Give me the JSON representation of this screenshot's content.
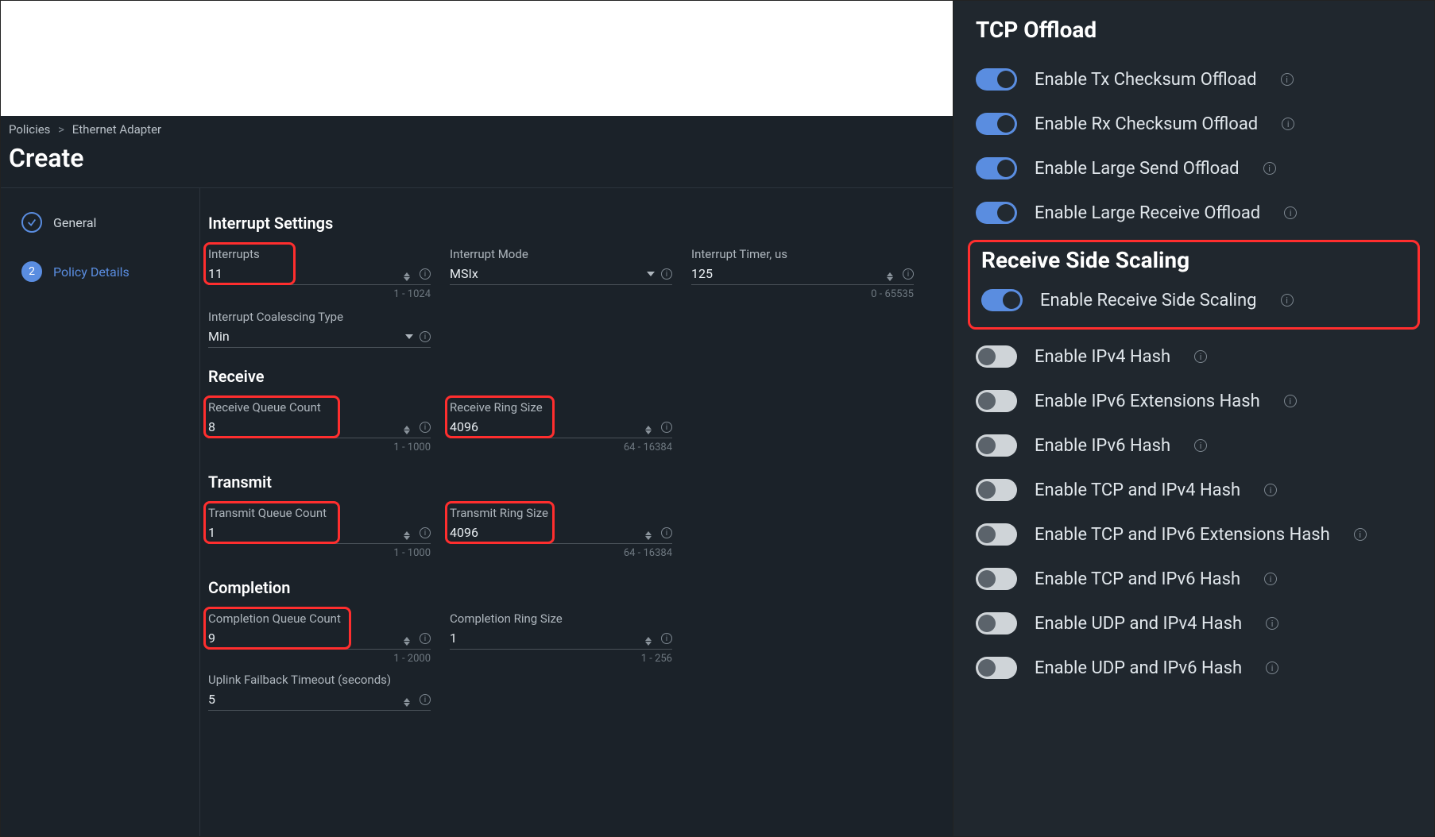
{
  "breadcrumb": {
    "level1": "Policies",
    "level2": "Ethernet Adapter"
  },
  "page_title": "Create",
  "steps": {
    "general": "General",
    "policy_details": "Policy Details",
    "policy_details_num": "2"
  },
  "sections": {
    "interrupt_settings": "Interrupt Settings",
    "receive": "Receive",
    "transmit": "Transmit",
    "completion": "Completion"
  },
  "fields": {
    "interrupts": {
      "label": "Interrupts",
      "value": "11",
      "hint": "1 - 1024"
    },
    "interrupt_mode": {
      "label": "Interrupt Mode",
      "value": "MSIx"
    },
    "interrupt_timer": {
      "label": "Interrupt Timer, us",
      "value": "125",
      "hint": "0 - 65535"
    },
    "coalescing_type": {
      "label": "Interrupt Coalescing Type",
      "value": "Min"
    },
    "rx_queue": {
      "label": "Receive Queue Count",
      "value": "8",
      "hint": "1 - 1000"
    },
    "rx_ring": {
      "label": "Receive Ring Size",
      "value": "4096",
      "hint": "64 - 16384"
    },
    "tx_queue": {
      "label": "Transmit Queue Count",
      "value": "1",
      "hint": "1 - 1000"
    },
    "tx_ring": {
      "label": "Transmit Ring Size",
      "value": "4096",
      "hint": "64 - 16384"
    },
    "cq_count": {
      "label": "Completion Queue Count",
      "value": "9",
      "hint": "1 - 2000"
    },
    "cq_ring": {
      "label": "Completion Ring Size",
      "value": "1",
      "hint": "1 - 256"
    },
    "failback": {
      "label": "Uplink Failback Timeout (seconds)",
      "value": "5"
    }
  },
  "right": {
    "tcp_title": "TCP Offload",
    "rss_title": "Receive Side Scaling",
    "toggles": {
      "tx_checksum": {
        "label": "Enable Tx Checksum Offload",
        "on": true
      },
      "rx_checksum": {
        "label": "Enable Rx Checksum Offload",
        "on": true
      },
      "large_send": {
        "label": "Enable Large Send Offload",
        "on": true
      },
      "large_recv": {
        "label": "Enable Large Receive Offload",
        "on": true
      },
      "rss": {
        "label": "Enable Receive Side Scaling",
        "on": true
      },
      "ipv4_hash": {
        "label": "Enable IPv4 Hash",
        "on": false
      },
      "ipv6_ext_hash": {
        "label": "Enable IPv6 Extensions Hash",
        "on": false
      },
      "ipv6_hash": {
        "label": "Enable IPv6 Hash",
        "on": false
      },
      "tcp_ipv4_hash": {
        "label": "Enable TCP and IPv4 Hash",
        "on": false
      },
      "tcp_ipv6_ext_hash": {
        "label": "Enable TCP and IPv6 Extensions Hash",
        "on": false
      },
      "tcp_ipv6_hash": {
        "label": "Enable TCP and IPv6 Hash",
        "on": false
      },
      "udp_ipv4_hash": {
        "label": "Enable UDP and IPv4 Hash",
        "on": false
      },
      "udp_ipv6_hash": {
        "label": "Enable UDP and IPv6 Hash",
        "on": false
      }
    }
  }
}
